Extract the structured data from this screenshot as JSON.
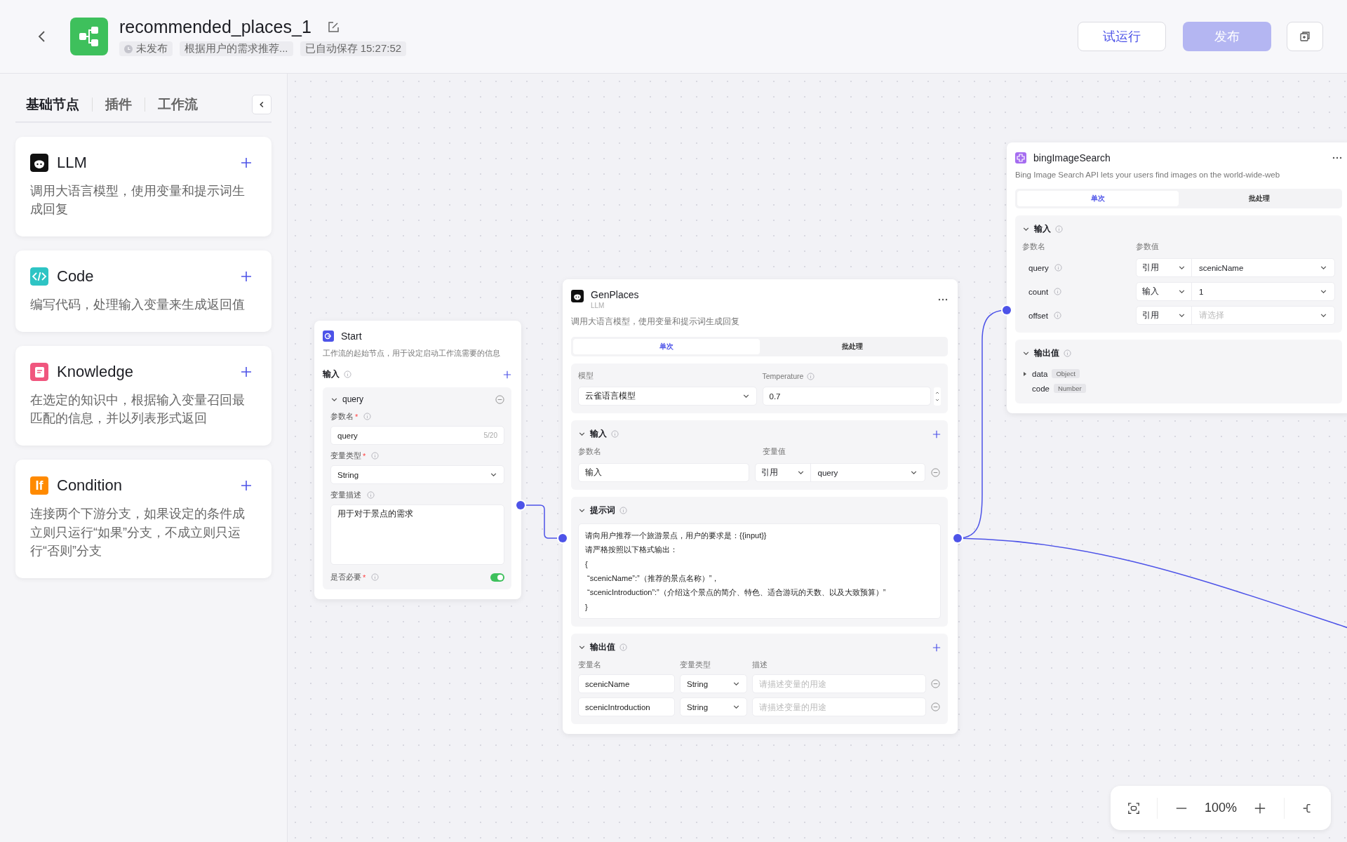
{
  "header": {
    "title": "recommended_places_1",
    "status": "未发布",
    "description": "根据用户的需求推荐...",
    "autosave": "已自动保存 15:27:52",
    "buttons": [
      {
        "label": "试运行",
        "kind": "secondary"
      },
      {
        "label": "发布",
        "kind": "primary"
      }
    ]
  },
  "sidebar": {
    "tabs": [
      {
        "label": "基础节点",
        "selected": true
      },
      {
        "label": "插件",
        "selected": false
      },
      {
        "label": "工作流",
        "selected": false
      }
    ],
    "nodes": [
      {
        "kind": "llm",
        "title": "LLM",
        "description": "调用大语言模型，使用变量和提示词生成回复"
      },
      {
        "kind": "code",
        "title": "Code",
        "description": "编写代码，处理输入变量来生成返回值"
      },
      {
        "kind": "knowledge",
        "title": "Knowledge",
        "description": "在选定的知识中，根据输入变量召回最匹配的信息，并以列表形式返回"
      },
      {
        "kind": "condition",
        "title": "Condition",
        "icon_text": "If",
        "description": "连接两个下游分支，如果设定的条件成立则只运行“如果”分支，不成立则只运行“否则”分支"
      }
    ]
  },
  "start_node": {
    "title": "Start",
    "description": "工作流的起始节点，用于设定启动工作流需要的信息",
    "section": "输入",
    "required_mark": "*",
    "param": {
      "name": "query",
      "name_label": "参数名",
      "name_value": "query",
      "counter": "5/20",
      "type_label": "变量类型",
      "type_value": "String",
      "desc_label": "变量描述",
      "desc_value": "用于对于景点的需求",
      "required_label": "是否必要",
      "required_on": true
    }
  },
  "llm_node": {
    "title": "GenPlaces",
    "subtitle": "LLM",
    "description": "调用大语言模型，使用变量和提示词生成回复",
    "modes": [
      {
        "label": "单次",
        "selected": true
      },
      {
        "label": "批处理",
        "selected": false
      }
    ],
    "model_label": "模型",
    "model_value": "云雀语言模型",
    "temperature_label": "Temperature",
    "temperature_value": "0.7",
    "input_section": "输入",
    "input_columns": [
      "参数名",
      "变量值"
    ],
    "inputs": [
      {
        "name": "输入",
        "source": "引用",
        "value": "query"
      }
    ],
    "prompt_section": "提示词",
    "prompt": "请向用户推荐一个旅游景点，用户的要求是：{{input}}\n请严格按照以下格式输出：\n{\n “scenicName”:”（推荐的景点名称）”，\n “scenicIntroduction”:”（介绍这个景点的简介、特色、适合游玩的天数、以及大致预算）”\n}",
    "output_section": "输出值",
    "output_columns": [
      "变量名",
      "变量类型",
      "描述"
    ],
    "outputs": [
      {
        "name": "scenicName",
        "type": "String",
        "placeholder": "请描述变量的用途"
      },
      {
        "name": "scenicIntroduction",
        "type": "String",
        "placeholder": "请描述变量的用途"
      }
    ]
  },
  "plugin_node": {
    "title": "bingImageSearch",
    "description": "Bing Image Search API lets your users find images on the world-wide-web",
    "modes": [
      {
        "label": "单次",
        "selected": true
      },
      {
        "label": "批处理",
        "selected": false
      }
    ],
    "input_section": "输入",
    "input_columns": [
      "参数名",
      "参数值"
    ],
    "inputs": [
      {
        "name": "query",
        "source": "引用",
        "value": "scenicName"
      },
      {
        "name": "count",
        "source": "输入",
        "value": "1"
      },
      {
        "name": "offset",
        "source": "引用",
        "placeholder": "请选择"
      }
    ],
    "output_section": "输出值",
    "outputs": [
      {
        "name": "data",
        "type": "Object",
        "expandable": true
      },
      {
        "name": "code",
        "type": "Number",
        "expandable": false
      }
    ]
  },
  "zoom": {
    "label": "100%"
  }
}
